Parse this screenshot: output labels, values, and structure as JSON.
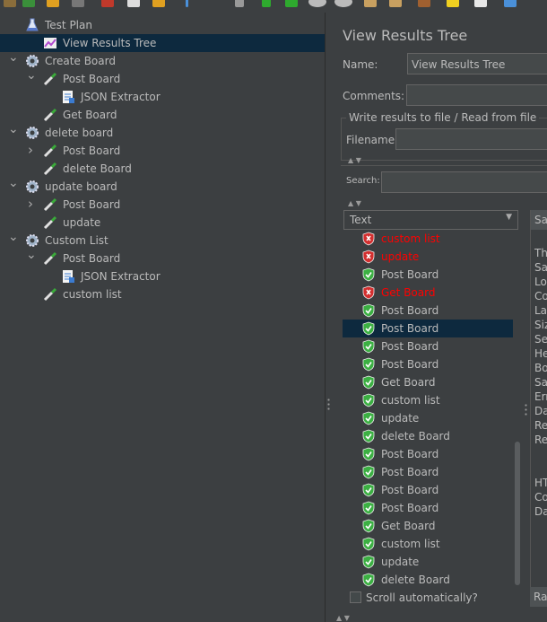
{
  "tree": [
    {
      "label": "Test Plan",
      "icon": "flask-icon",
      "expander": ""
    },
    {
      "label": "View Results Tree",
      "icon": "listener-chart-icon",
      "expander": "",
      "selected": true
    },
    {
      "label": "Create Board",
      "icon": "thread-group-gear-icon",
      "expander": "v"
    },
    {
      "label": "Post Board",
      "icon": "pipette-sampler-icon",
      "expander": "v"
    },
    {
      "label": "JSON Extractor",
      "icon": "extractor-document-icon",
      "expander": ""
    },
    {
      "label": "Get Board",
      "icon": "pipette-sampler-icon",
      "expander": ""
    },
    {
      "label": "delete board",
      "icon": "thread-group-gear-icon",
      "expander": "v"
    },
    {
      "label": "Post Board",
      "icon": "pipette-sampler-icon",
      "expander": ">"
    },
    {
      "label": "delete Board",
      "icon": "pipette-sampler-icon",
      "expander": ""
    },
    {
      "label": "update board",
      "icon": "thread-group-gear-icon",
      "expander": "v"
    },
    {
      "label": "Post Board",
      "icon": "pipette-sampler-icon",
      "expander": ">"
    },
    {
      "label": "update",
      "icon": "pipette-sampler-icon",
      "expander": ""
    },
    {
      "label": "Custom List",
      "icon": "thread-group-gear-icon",
      "expander": "v"
    },
    {
      "label": "Post Board",
      "icon": "pipette-sampler-icon",
      "expander": "v"
    },
    {
      "label": "JSON Extractor",
      "icon": "extractor-document-icon",
      "expander": ""
    },
    {
      "label": "custom list",
      "icon": "pipette-sampler-icon",
      "expander": ""
    }
  ],
  "panel": {
    "title": "View Results Tree",
    "name_label": "Name:",
    "name_value": "View Results Tree",
    "comments_label": "Comments:",
    "group_title": "Write results to file / Read from file",
    "filename_label": "Filename",
    "search_label": "Search:",
    "renderer_value": "Text",
    "side_tab_label": "Sa",
    "side_bottom_label": "Ra",
    "side_lines": [
      "Th",
      "Sa",
      "Lo",
      "Co",
      "La",
      "Siz",
      "Se",
      "He",
      "Bo",
      "Sa",
      "Err",
      "Da",
      "Re",
      "Re",
      "",
      "",
      "HT",
      "Co",
      "Da"
    ],
    "scroll_auto_label": "Scroll automatically?"
  },
  "results": [
    {
      "label": "custom list",
      "status": "error"
    },
    {
      "label": "update",
      "status": "error"
    },
    {
      "label": "Post Board",
      "status": "success"
    },
    {
      "label": "Get Board",
      "status": "error"
    },
    {
      "label": "Post Board",
      "status": "success"
    },
    {
      "label": "Post Board",
      "status": "success",
      "selected": true
    },
    {
      "label": "Post Board",
      "status": "success"
    },
    {
      "label": "Post Board",
      "status": "success"
    },
    {
      "label": "Get Board",
      "status": "success"
    },
    {
      "label": "custom list",
      "status": "success"
    },
    {
      "label": "update",
      "status": "success"
    },
    {
      "label": "delete Board",
      "status": "success"
    },
    {
      "label": "Post Board",
      "status": "success"
    },
    {
      "label": "Post Board",
      "status": "success"
    },
    {
      "label": "Post Board",
      "status": "success"
    },
    {
      "label": "Post Board",
      "status": "success"
    },
    {
      "label": "Get Board",
      "status": "success"
    },
    {
      "label": "custom list",
      "status": "success"
    },
    {
      "label": "update",
      "status": "success"
    },
    {
      "label": "delete Board",
      "status": "success"
    }
  ],
  "colors": {
    "error_text": "#ff0000",
    "success_shield": "#3cb043",
    "error_shield": "#d32f2f",
    "selection": "#0d293e"
  }
}
